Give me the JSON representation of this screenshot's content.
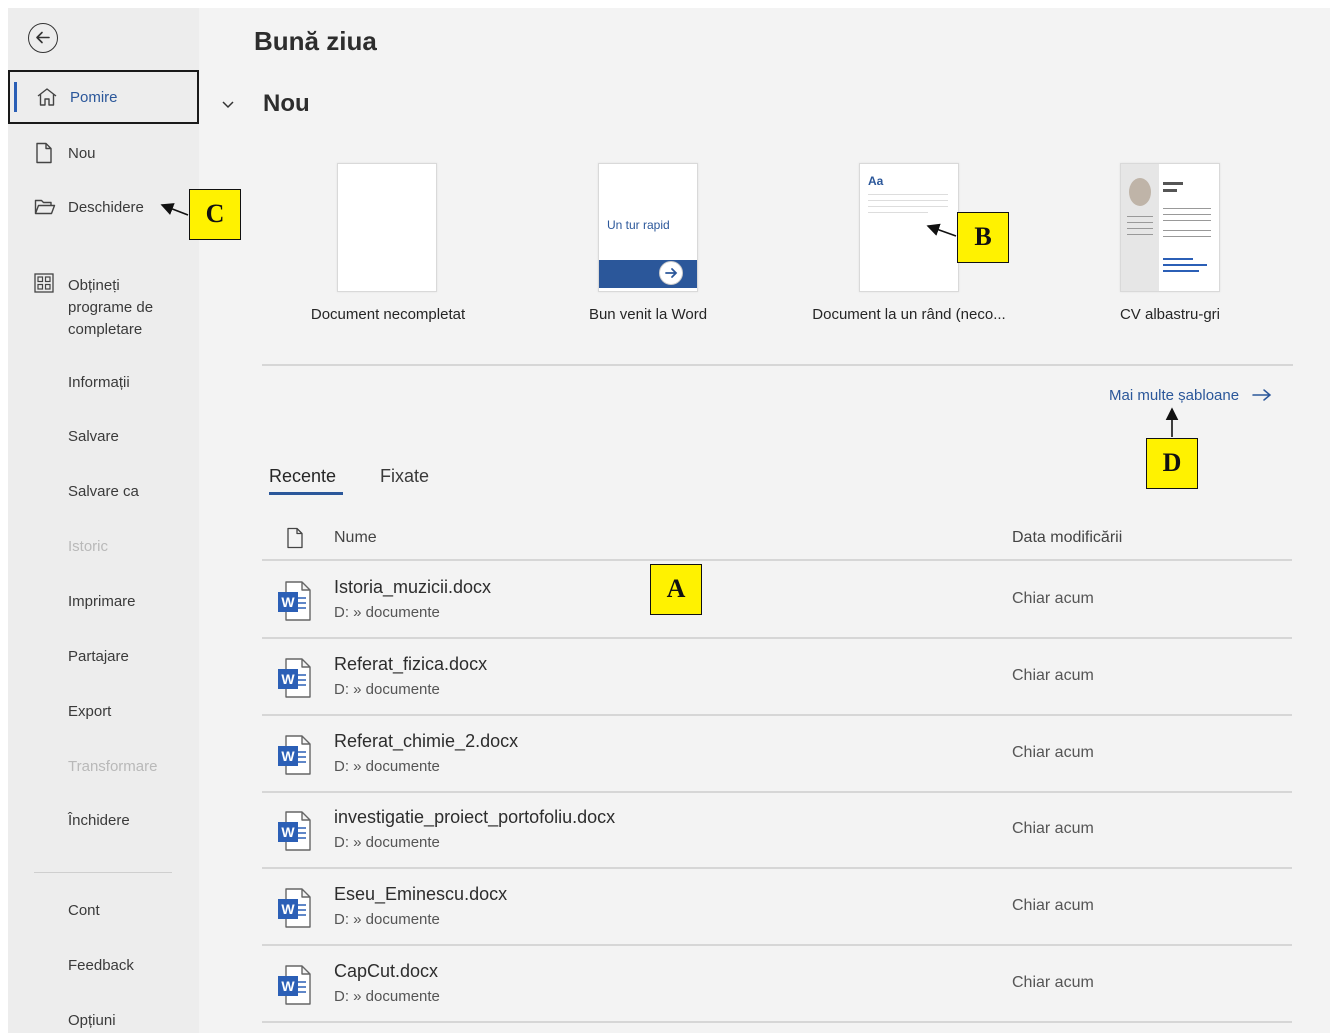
{
  "sidebar": {
    "items": [
      {
        "label": "Pomire",
        "icon": "home-icon"
      },
      {
        "label": "Nou",
        "icon": "new-document-icon"
      },
      {
        "label": "Deschidere",
        "icon": "folder-open-icon"
      },
      {
        "label": "Obțineṭi programe de completare",
        "icon": "add-ins-icon"
      },
      {
        "label": "Informații"
      },
      {
        "label": "Salvare"
      },
      {
        "label": "Salvare ca"
      },
      {
        "label": "Istoric",
        "disabled": true
      },
      {
        "label": "Imprimare"
      },
      {
        "label": "Partajare"
      },
      {
        "label": "Export"
      },
      {
        "label": "Transformare",
        "disabled": true
      },
      {
        "label": "Închidere"
      }
    ],
    "bottom": [
      {
        "label": "Cont"
      },
      {
        "label": "Feedback"
      },
      {
        "label": "Opțiuni"
      }
    ]
  },
  "main": {
    "greeting": "Bună ziua",
    "new_section": {
      "title": "Nou",
      "templates": [
        {
          "caption": "Document necompletat"
        },
        {
          "caption": "Bun venit la Word",
          "thumb_text": "Un tur rapid"
        },
        {
          "caption": "Document la un rând (neco...",
          "thumb_text": "Aa"
        },
        {
          "caption": "CV albastru-gri"
        }
      ],
      "more_link": "Mai multe șabloane"
    },
    "tabs": [
      {
        "label": "Recente",
        "active": true
      },
      {
        "label": "Fixate",
        "active": false
      }
    ],
    "list": {
      "headers": {
        "name": "Nume",
        "date": "Data modificării"
      },
      "rows": [
        {
          "name": "Istoria_muzicii.docx",
          "path": "D: » documente",
          "date": "Chiar acum"
        },
        {
          "name": "Referat_fizica.docx",
          "path": "D: » documente",
          "date": "Chiar acum"
        },
        {
          "name": "Referat_chimie_2.docx",
          "path": "D: » documente",
          "date": "Chiar acum"
        },
        {
          "name": "investigatie_proiect_portofoliu.docx",
          "path": "D: » documente",
          "date": "Chiar acum"
        },
        {
          "name": "Eseu_Eminescu.docx",
          "path": "D: » documente",
          "date": "Chiar acum"
        },
        {
          "name": "CapCut.docx",
          "path": "D: » documente",
          "date": "Chiar acum"
        }
      ]
    }
  },
  "callouts": {
    "a": "A",
    "b": "B",
    "c": "C",
    "d": "D"
  },
  "colors": {
    "accent": "#2b579a",
    "callout": "#fff200",
    "word_blue": "#2b5fb6"
  }
}
